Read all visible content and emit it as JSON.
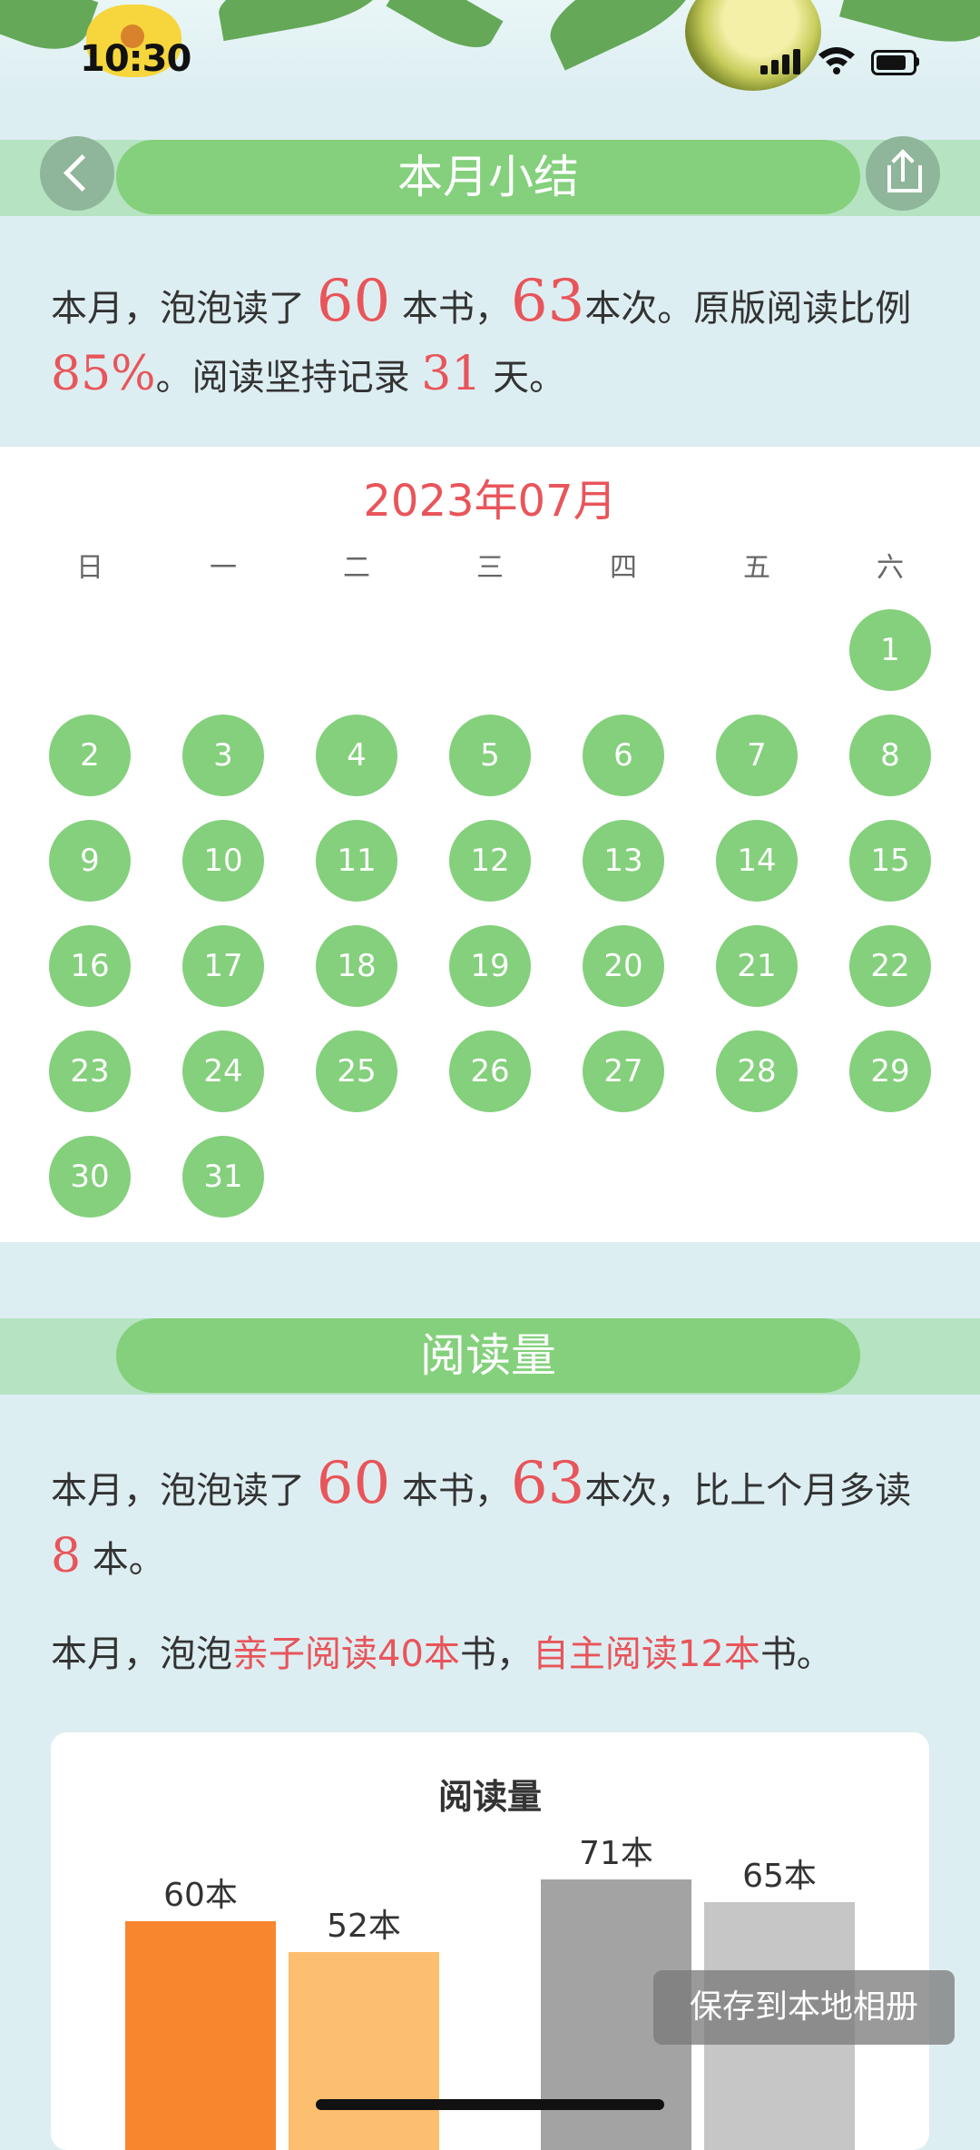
{
  "status_bar": {
    "time": "10:30"
  },
  "header": {
    "title": "本月小结"
  },
  "summary": {
    "prefix": "本月，泡泡读了 ",
    "books": "60",
    "books_suffix": " 本书，",
    "times": "63",
    "times_suffix": "本次。原版阅读比例",
    "original_pct": "85%",
    "streak_prefix": "。阅读坚持记录 ",
    "streak_days": "31",
    "streak_suffix": " 天。"
  },
  "calendar": {
    "month_label": "2023年07月",
    "weekdays": [
      "日",
      "一",
      "二",
      "三",
      "四",
      "五",
      "六"
    ],
    "days": [
      "1",
      "2",
      "3",
      "4",
      "5",
      "6",
      "7",
      "8",
      "9",
      "10",
      "11",
      "12",
      "13",
      "14",
      "15",
      "16",
      "17",
      "18",
      "19",
      "20",
      "21",
      "22",
      "23",
      "24",
      "25",
      "26",
      "27",
      "28",
      "29",
      "30",
      "31"
    ]
  },
  "reading_section": {
    "title": "阅读量",
    "line1_prefix": "本月，泡泡读了 ",
    "books": "60",
    "books_suffix": " 本书，",
    "times": "63",
    "times_suffix": "本次，比上个月多读",
    "more": "8",
    "more_suffix": " 本。",
    "line2_prefix": "本月，泡泡",
    "parent_reading": "亲子阅读40本",
    "mid": "书，",
    "self_reading": "自主阅读12本",
    "line2_suffix": "书。"
  },
  "chart_data": {
    "type": "bar",
    "title": "阅读量",
    "categories": [
      "",
      "",
      "",
      ""
    ],
    "values": [
      60,
      52,
      71,
      65
    ],
    "value_labels": [
      "60本",
      "52本",
      "71本",
      "65本"
    ],
    "colors": [
      "#f7862f",
      "#fcbe6f",
      "#a3a3a3",
      "#c6c6c6"
    ],
    "ylim": [
      0,
      80
    ]
  },
  "toast": {
    "label": "保存到本地相册"
  }
}
